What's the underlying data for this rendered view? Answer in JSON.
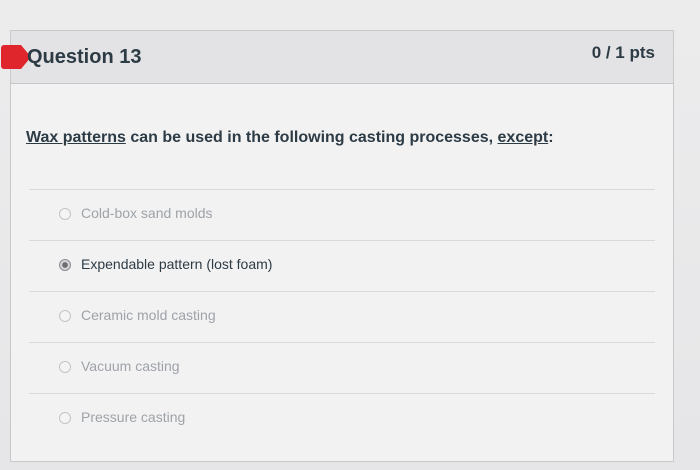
{
  "question": {
    "title": "Question 13",
    "points": "0 / 1 pts",
    "text_part1": "Wax patterns",
    "text_part2": " can be used in the following casting processes, ",
    "text_part3": "except",
    "text_part4": ":",
    "status_color": "#e0262d"
  },
  "answers": [
    {
      "label": "Cold-box sand molds",
      "selected": false
    },
    {
      "label": "Expendable pattern (lost foam)",
      "selected": true
    },
    {
      "label": "Ceramic mold casting",
      "selected": false
    },
    {
      "label": "Vacuum casting",
      "selected": false
    },
    {
      "label": "Pressure casting",
      "selected": false
    }
  ]
}
